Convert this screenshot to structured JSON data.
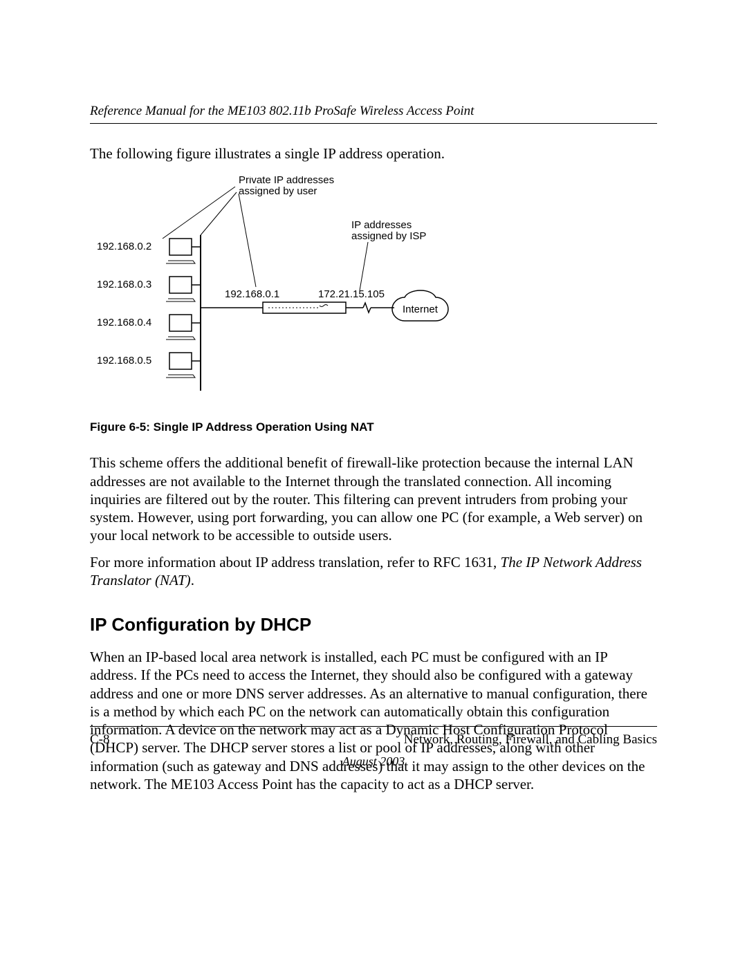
{
  "header": {
    "title": "Reference Manual for the ME103 802.11b ProSafe Wireless Access Point"
  },
  "intro": "The following figure illustrates a single IP address operation.",
  "figure": {
    "private_label_l1": "Private IP addresses",
    "private_label_l2": "assigned by user",
    "isp_label_l1": "IP addresses",
    "isp_label_l2": "assigned by ISP",
    "pc_ips": [
      "192.168.0.2",
      "192.168.0.3",
      "192.168.0.4",
      "192.168.0.5"
    ],
    "router_lan_ip": "192.168.0.1",
    "router_wan_ip": "172.21.15.105",
    "cloud_label": "Internet",
    "caption": "Figure 6-5:  Single IP Address Operation Using NAT"
  },
  "para1": "This scheme offers the additional benefit of firewall-like protection because the internal LAN addresses are not available to the Internet through the translated connection. All incoming inquiries are filtered out by the router. This filtering can prevent intruders from probing your system. However, using port forwarding, you can allow one PC (for example, a Web server) on your local network to be accessible to outside users.",
  "para2_pre": "For more information about IP address translation, refer to RFC 1631, ",
  "para2_italic": "The IP Network Address Translator (NAT)",
  "para2_post": ".",
  "section_heading": "IP Configuration by DHCP",
  "para3": "When an IP-based local area network is installed, each PC must be configured with an IP address. If the PCs need to access the Internet, they should also be configured with a gateway address and one or more DNS server addresses. As an alternative to manual configuration, there is a method by which each PC on the network can automatically obtain this configuration information. A device on the network may act as a Dynamic Host Configuration Protocol (DHCP) server. The DHCP server stores a list or pool of IP addresses, along with other information (such as gateway and DNS addresses) that it may assign to the other devices on the network. The ME103 Access Point has the capacity to act as a DHCP server.",
  "footer": {
    "page_no": "C-8",
    "section": "Network, Routing, Firewall, and Cabling Basics",
    "date": "August 2003"
  }
}
